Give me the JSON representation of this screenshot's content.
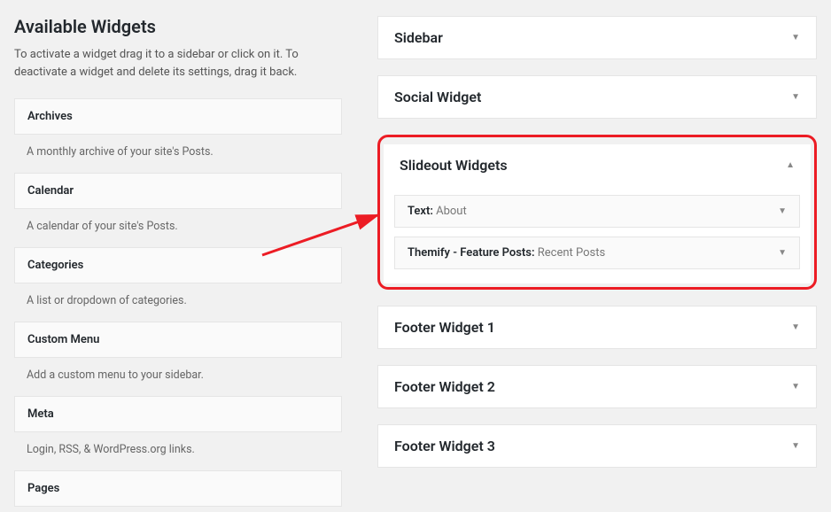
{
  "left": {
    "title": "Available Widgets",
    "description": "To activate a widget drag it to a sidebar or click on it. To deactivate a widget and delete its settings, drag it back.",
    "widgets": [
      {
        "name": "Archives",
        "desc": "A monthly archive of your site's Posts."
      },
      {
        "name": "Calendar",
        "desc": "A calendar of your site's Posts."
      },
      {
        "name": "Categories",
        "desc": "A list or dropdown of categories."
      },
      {
        "name": "Custom Menu",
        "desc": "Add a custom menu to your sidebar."
      },
      {
        "name": "Meta",
        "desc": "Login, RSS, & WordPress.org links."
      },
      {
        "name": "Pages",
        "desc": ""
      }
    ]
  },
  "areas": {
    "sidebar": "Sidebar",
    "social": "Social Widget",
    "slideout": "Slideout Widgets",
    "footer1": "Footer Widget 1",
    "footer2": "Footer Widget 2",
    "footer3": "Footer Widget 3"
  },
  "slideout_items": [
    {
      "title": "Text:",
      "sub": " About"
    },
    {
      "title": "Themify - Feature Posts:",
      "sub": " Recent Posts"
    }
  ]
}
